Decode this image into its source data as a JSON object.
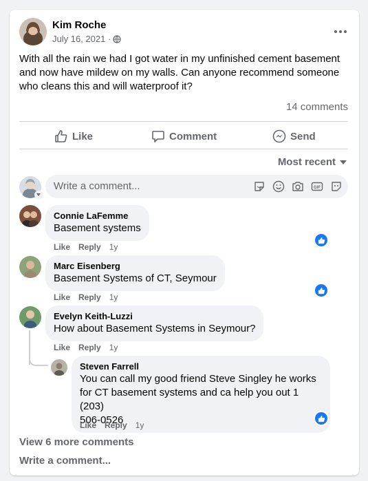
{
  "post": {
    "author": "Kim Roche",
    "date": "July 16, 2021 ·",
    "text": "With all the rain we had I got water in my unfinished cement basement and now have mildew on my walls.  Can anyone recommend someone who cleans this and will waterproof it?",
    "comments_count": "14 comments"
  },
  "actions": {
    "like": "Like",
    "comment": "Comment",
    "send": "Send"
  },
  "sort": {
    "label": "Most recent"
  },
  "composer": {
    "placeholder": "Write a comment..."
  },
  "comments": [
    {
      "name": "Connie LaFemme",
      "text": "Basement systems",
      "like": "Like",
      "reply": "Reply",
      "time": "1y"
    },
    {
      "name": "Marc Eisenberg",
      "text": "Basement Systems of CT, Seymour",
      "like": "Like",
      "reply": "Reply",
      "time": "1y"
    },
    {
      "name": "Evelyn Keith-Luzzi",
      "text": "How about Basement Systems in Seymour?",
      "like": "Like",
      "reply": "Reply",
      "time": "1y"
    }
  ],
  "reply": {
    "name": "Steven Farrell",
    "lines": [
      "You can call my good friend Steve Singley he works",
      "for CT basement systems and ca help you out 1 (203)",
      "506-0526"
    ],
    "like": "Like",
    "reply": "Reply",
    "time": "1y"
  },
  "footer": {
    "view_more": "View 6 more comments",
    "write": "Write a comment..."
  },
  "colors": {
    "accent": "#1877f2",
    "secondary_text": "#65676b",
    "bubble": "#f0f2f5"
  },
  "icons": [
    "globe-icon",
    "more-icon",
    "thumbs-up-icon",
    "comment-icon",
    "messenger-icon",
    "sticker-icon",
    "emoji-icon",
    "camera-icon",
    "gif-icon",
    "avatar-sticker-icon",
    "like-reaction-icon",
    "caret-down-icon"
  ]
}
